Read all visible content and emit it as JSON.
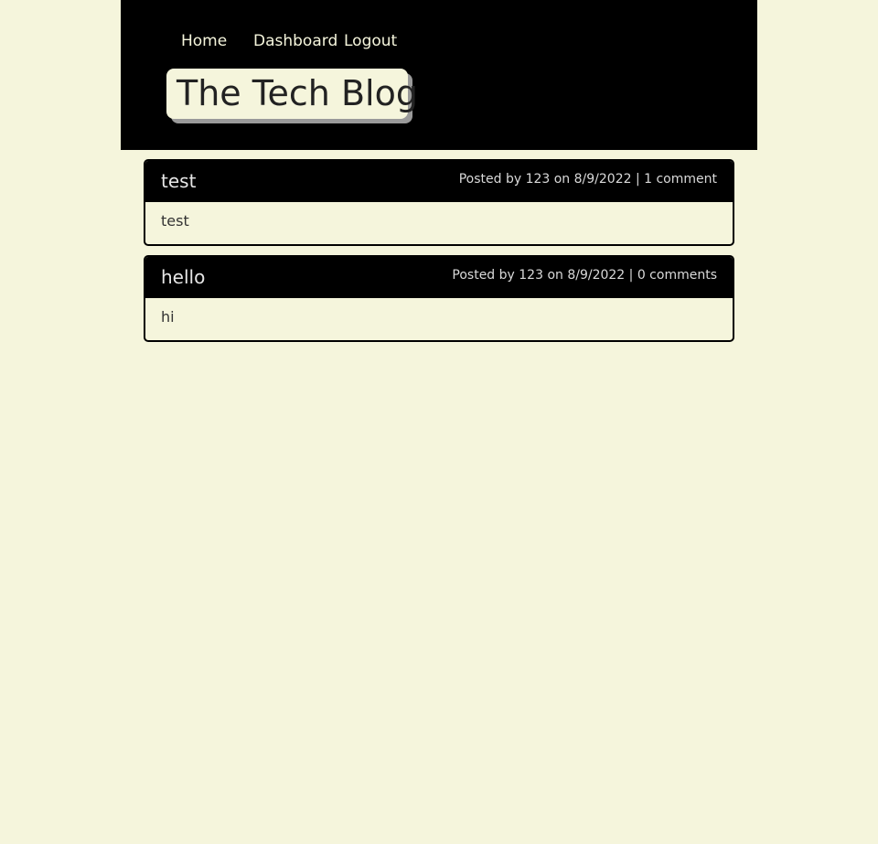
{
  "nav": {
    "home": "Home",
    "dashboard": "Dashboard",
    "logout": "Logout"
  },
  "site": {
    "title": "The Tech Blog"
  },
  "posts": [
    {
      "title": "test",
      "author": "123",
      "date": "8/9/2022",
      "meta": "Posted by 123 on 8/9/2022 | 1 comment",
      "body": "test"
    },
    {
      "title": "hello",
      "author": "123",
      "date": "8/9/2022",
      "meta": "Posted by 123 on 8/9/2022 | 0 comments",
      "body": "hi"
    }
  ],
  "colors": {
    "background": "#f5f5dc",
    "header": "#000000",
    "brand_bg": "#f5f5dc",
    "brand_shadow": "#9a9a9a"
  }
}
